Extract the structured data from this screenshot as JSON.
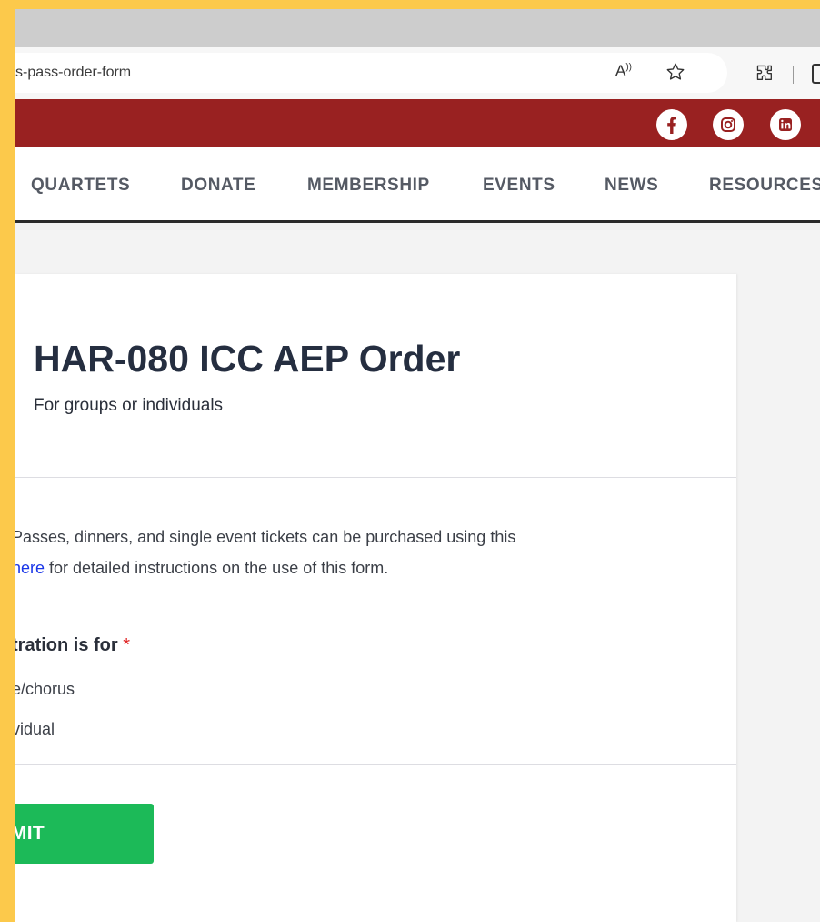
{
  "browser": {
    "url": "s-pass-order-form",
    "read_aloud": "A",
    "read_aloud_sup": "))"
  },
  "nav": {
    "items": [
      "QUARTETS",
      "DONATE",
      "MEMBERSHIP",
      "EVENTS",
      "NEWS",
      "RESOURCES"
    ]
  },
  "form": {
    "title": "HAR-080 ICC AEP Order",
    "subtitle": "For groups or individuals",
    "description_line1": "Passes, dinners, and single event tickets can be purchased using this",
    "link_text": "here",
    "description_line2_rest": " for detailed instructions on the use of this form.",
    "field_label": "tration is for",
    "required_mark": "*",
    "options": [
      "e/chorus",
      "vidual"
    ],
    "submit_label": "UBMIT"
  },
  "colors": {
    "frame": "#FCC94B",
    "topbar": "#992121",
    "submit": "#1CBA58",
    "link": "#1A36E8",
    "required": "#E02424"
  },
  "icons": [
    "read-aloud-icon",
    "favorite-star-icon",
    "extensions-icon",
    "profile-icon",
    "facebook-icon",
    "instagram-icon",
    "linkedin-icon"
  ]
}
